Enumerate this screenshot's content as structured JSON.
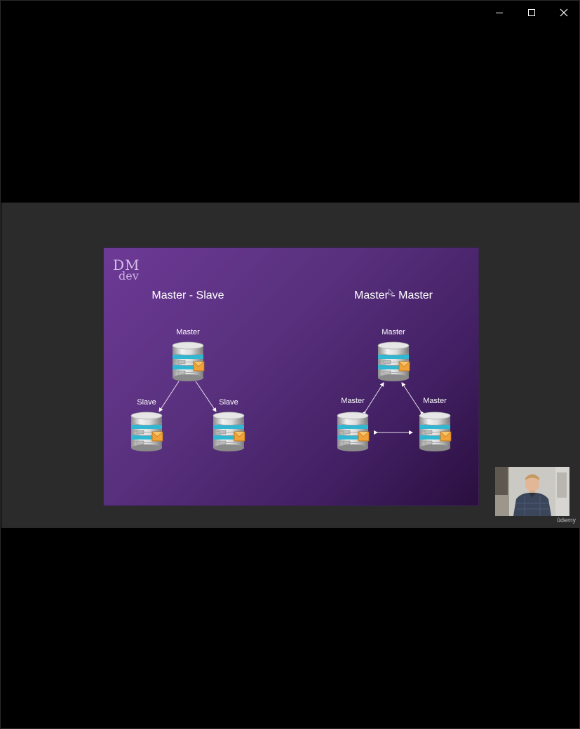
{
  "window": {
    "controls": [
      "minimize-icon",
      "maximize-icon",
      "close-icon"
    ]
  },
  "slide": {
    "logo": {
      "line1": "DM",
      "line2": "dev"
    },
    "left": {
      "title": "Master - Slave",
      "top_label": "Master",
      "left_label": "Slave",
      "right_label": "Slave"
    },
    "right": {
      "title": "Master - Master",
      "top_label": "Master",
      "left_label": "Master",
      "right_label": "Master"
    },
    "icons": [
      "database-server-icon"
    ]
  },
  "overlay": {
    "watermark": "ûdemy"
  },
  "colors": {
    "slide_bg_start": "#6d3a96",
    "slide_bg_end": "#2a0f3f",
    "player_bg": "#2b2b2b",
    "window_bg": "#000000"
  }
}
